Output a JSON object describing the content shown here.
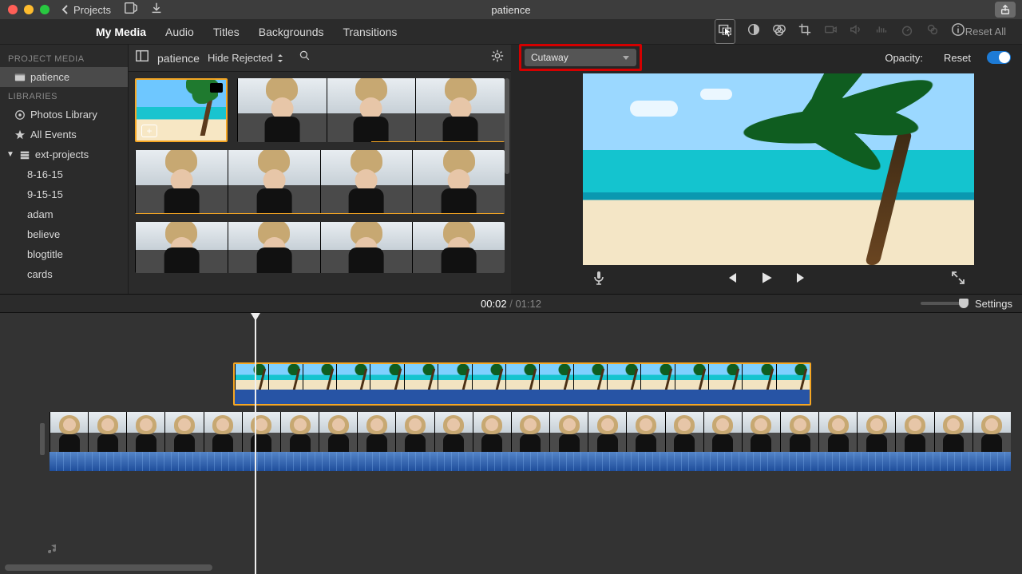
{
  "window": {
    "title": "patience",
    "back_label": "Projects"
  },
  "media_tabs": [
    "My Media",
    "Audio",
    "Titles",
    "Backgrounds",
    "Transitions"
  ],
  "media_active": 0,
  "sidebar": {
    "project_head": "PROJECT MEDIA",
    "project_name": "patience",
    "libraries_head": "LIBRARIES",
    "libs": [
      "Photos Library",
      "All Events",
      "ext-projects"
    ],
    "events": [
      "8-16-15",
      "9-15-15",
      "adam",
      "believe",
      "blogtitle",
      "cards"
    ]
  },
  "browser": {
    "title": "patience",
    "hide_label": "Hide Rejected"
  },
  "overlay": {
    "mode": "Cutaway",
    "opacity_label": "Opacity:",
    "reset_label": "Reset",
    "reset_all": "Reset All"
  },
  "time": {
    "current": "00:02",
    "separator": "/",
    "total": "01:12"
  },
  "settings_label": "Settings"
}
